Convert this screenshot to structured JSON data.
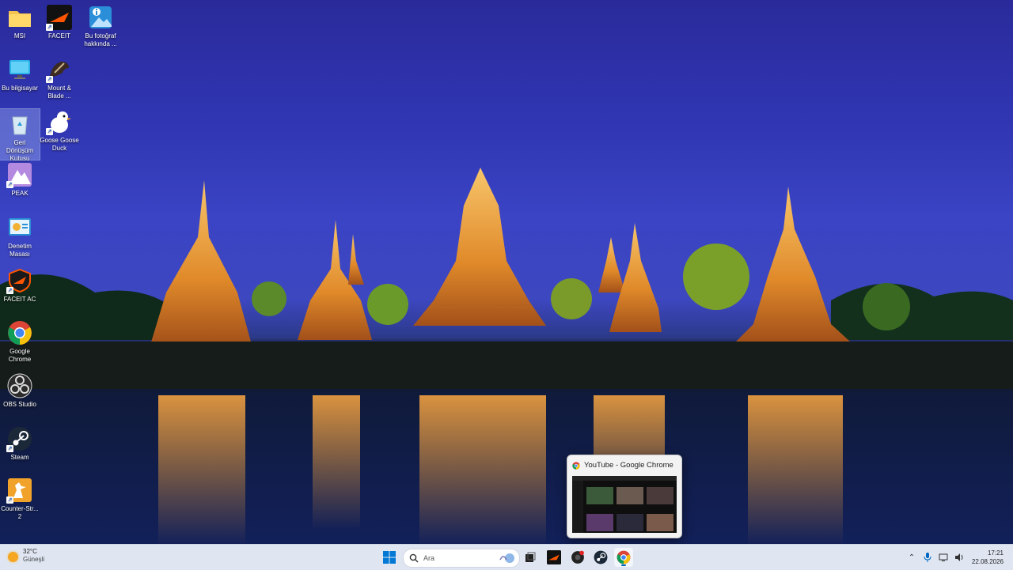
{
  "desktop": {
    "icons": [
      {
        "label": "MSI",
        "icon": "folder-icon"
      },
      {
        "label": "FACEIT",
        "icon": "faceit-icon"
      },
      {
        "label": "Bu fotoğraf hakkında ...",
        "icon": "photo-info-icon"
      },
      {
        "label": "Bu bilgisayar",
        "icon": "computer-icon"
      },
      {
        "label": "Mount & Blade ...",
        "icon": "mount-blade-icon"
      },
      {
        "label": "Geri Dönüşüm Kutusu",
        "icon": "recycle-bin-icon"
      },
      {
        "label": "Goose Goose Duck",
        "icon": "goose-goose-duck-icon"
      },
      {
        "label": "PEAK",
        "icon": "peak-icon"
      },
      {
        "label": "Denetim Masası",
        "icon": "control-panel-icon"
      },
      {
        "label": "FACEIT AC",
        "icon": "faceit-ac-icon"
      },
      {
        "label": "Google Chrome",
        "icon": "chrome-icon"
      },
      {
        "label": "OBS Studio",
        "icon": "obs-icon"
      },
      {
        "label": "Steam",
        "icon": "steam-icon"
      },
      {
        "label": "Counter-Str... 2",
        "icon": "counter-strike-icon"
      }
    ]
  },
  "preview": {
    "title": "YouTube - Google Chrome"
  },
  "taskbar": {
    "weather": {
      "temp": "32°C",
      "condition": "Güneşli"
    },
    "search_placeholder": "Ara",
    "clock": {
      "time": "17:21",
      "date": "22.08.2026"
    }
  },
  "colors": {
    "taskbar_bg": "#dfe6f2",
    "accent": "#0067c0"
  }
}
